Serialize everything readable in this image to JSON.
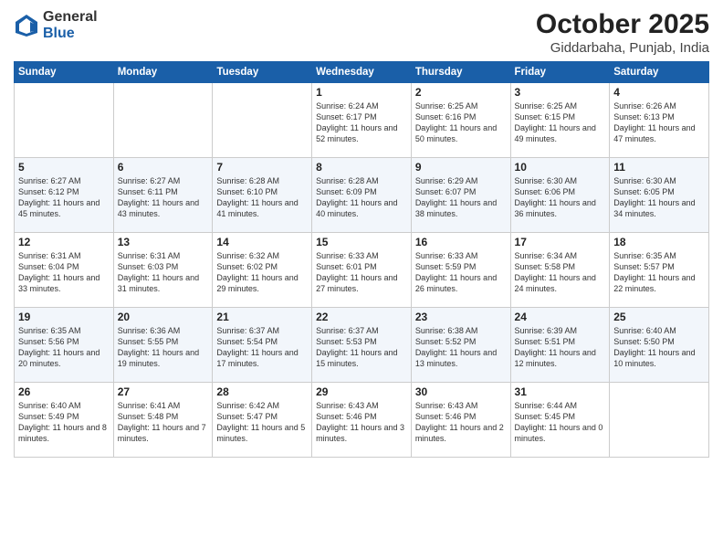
{
  "logo": {
    "general": "General",
    "blue": "Blue"
  },
  "header": {
    "month": "October 2025",
    "location": "Giddarbaha, Punjab, India"
  },
  "days_of_week": [
    "Sunday",
    "Monday",
    "Tuesday",
    "Wednesday",
    "Thursday",
    "Friday",
    "Saturday"
  ],
  "weeks": [
    [
      {
        "day": "",
        "info": ""
      },
      {
        "day": "",
        "info": ""
      },
      {
        "day": "",
        "info": ""
      },
      {
        "day": "1",
        "info": "Sunrise: 6:24 AM\nSunset: 6:17 PM\nDaylight: 11 hours\nand 52 minutes."
      },
      {
        "day": "2",
        "info": "Sunrise: 6:25 AM\nSunset: 6:16 PM\nDaylight: 11 hours\nand 50 minutes."
      },
      {
        "day": "3",
        "info": "Sunrise: 6:25 AM\nSunset: 6:15 PM\nDaylight: 11 hours\nand 49 minutes."
      },
      {
        "day": "4",
        "info": "Sunrise: 6:26 AM\nSunset: 6:13 PM\nDaylight: 11 hours\nand 47 minutes."
      }
    ],
    [
      {
        "day": "5",
        "info": "Sunrise: 6:27 AM\nSunset: 6:12 PM\nDaylight: 11 hours\nand 45 minutes."
      },
      {
        "day": "6",
        "info": "Sunrise: 6:27 AM\nSunset: 6:11 PM\nDaylight: 11 hours\nand 43 minutes."
      },
      {
        "day": "7",
        "info": "Sunrise: 6:28 AM\nSunset: 6:10 PM\nDaylight: 11 hours\nand 41 minutes."
      },
      {
        "day": "8",
        "info": "Sunrise: 6:28 AM\nSunset: 6:09 PM\nDaylight: 11 hours\nand 40 minutes."
      },
      {
        "day": "9",
        "info": "Sunrise: 6:29 AM\nSunset: 6:07 PM\nDaylight: 11 hours\nand 38 minutes."
      },
      {
        "day": "10",
        "info": "Sunrise: 6:30 AM\nSunset: 6:06 PM\nDaylight: 11 hours\nand 36 minutes."
      },
      {
        "day": "11",
        "info": "Sunrise: 6:30 AM\nSunset: 6:05 PM\nDaylight: 11 hours\nand 34 minutes."
      }
    ],
    [
      {
        "day": "12",
        "info": "Sunrise: 6:31 AM\nSunset: 6:04 PM\nDaylight: 11 hours\nand 33 minutes."
      },
      {
        "day": "13",
        "info": "Sunrise: 6:31 AM\nSunset: 6:03 PM\nDaylight: 11 hours\nand 31 minutes."
      },
      {
        "day": "14",
        "info": "Sunrise: 6:32 AM\nSunset: 6:02 PM\nDaylight: 11 hours\nand 29 minutes."
      },
      {
        "day": "15",
        "info": "Sunrise: 6:33 AM\nSunset: 6:01 PM\nDaylight: 11 hours\nand 27 minutes."
      },
      {
        "day": "16",
        "info": "Sunrise: 6:33 AM\nSunset: 5:59 PM\nDaylight: 11 hours\nand 26 minutes."
      },
      {
        "day": "17",
        "info": "Sunrise: 6:34 AM\nSunset: 5:58 PM\nDaylight: 11 hours\nand 24 minutes."
      },
      {
        "day": "18",
        "info": "Sunrise: 6:35 AM\nSunset: 5:57 PM\nDaylight: 11 hours\nand 22 minutes."
      }
    ],
    [
      {
        "day": "19",
        "info": "Sunrise: 6:35 AM\nSunset: 5:56 PM\nDaylight: 11 hours\nand 20 minutes."
      },
      {
        "day": "20",
        "info": "Sunrise: 6:36 AM\nSunset: 5:55 PM\nDaylight: 11 hours\nand 19 minutes."
      },
      {
        "day": "21",
        "info": "Sunrise: 6:37 AM\nSunset: 5:54 PM\nDaylight: 11 hours\nand 17 minutes."
      },
      {
        "day": "22",
        "info": "Sunrise: 6:37 AM\nSunset: 5:53 PM\nDaylight: 11 hours\nand 15 minutes."
      },
      {
        "day": "23",
        "info": "Sunrise: 6:38 AM\nSunset: 5:52 PM\nDaylight: 11 hours\nand 13 minutes."
      },
      {
        "day": "24",
        "info": "Sunrise: 6:39 AM\nSunset: 5:51 PM\nDaylight: 11 hours\nand 12 minutes."
      },
      {
        "day": "25",
        "info": "Sunrise: 6:40 AM\nSunset: 5:50 PM\nDaylight: 11 hours\nand 10 minutes."
      }
    ],
    [
      {
        "day": "26",
        "info": "Sunrise: 6:40 AM\nSunset: 5:49 PM\nDaylight: 11 hours\nand 8 minutes."
      },
      {
        "day": "27",
        "info": "Sunrise: 6:41 AM\nSunset: 5:48 PM\nDaylight: 11 hours\nand 7 minutes."
      },
      {
        "day": "28",
        "info": "Sunrise: 6:42 AM\nSunset: 5:47 PM\nDaylight: 11 hours\nand 5 minutes."
      },
      {
        "day": "29",
        "info": "Sunrise: 6:43 AM\nSunset: 5:46 PM\nDaylight: 11 hours\nand 3 minutes."
      },
      {
        "day": "30",
        "info": "Sunrise: 6:43 AM\nSunset: 5:46 PM\nDaylight: 11 hours\nand 2 minutes."
      },
      {
        "day": "31",
        "info": "Sunrise: 6:44 AM\nSunset: 5:45 PM\nDaylight: 11 hours\nand 0 minutes."
      },
      {
        "day": "",
        "info": ""
      }
    ]
  ]
}
